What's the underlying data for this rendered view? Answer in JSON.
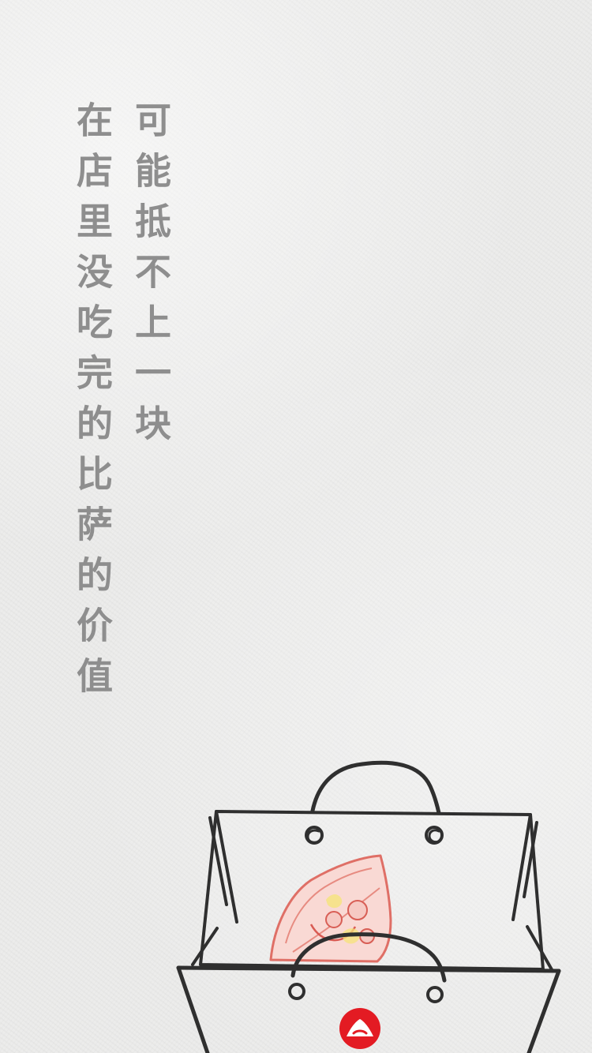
{
  "poem": {
    "line1": "可能抵不上一块",
    "line2": "在店里没吃完的比萨的价值"
  },
  "colors": {
    "background": "#ececeb",
    "text": "#8e8e8e",
    "ink": "#2f2f2f",
    "brand_red": "#e31b23",
    "pizza": "#e86f63"
  },
  "illustration": {
    "name": "takeaway-bag-with-pizza-slice",
    "logo": "pizza-hut-logo"
  }
}
